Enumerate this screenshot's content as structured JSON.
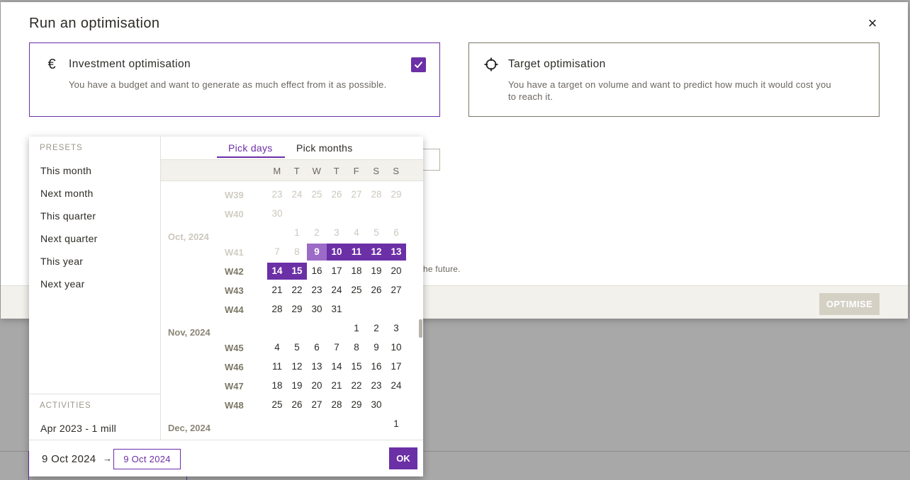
{
  "modal": {
    "title": "Run an optimisation",
    "close_icon": "×",
    "cards": {
      "investment": {
        "icon": "€",
        "title": "Investment optimisation",
        "description": "You have a budget and want to generate as much effect from it as possible.",
        "checked": true
      },
      "target": {
        "icon": "crosshair-icon",
        "title": "Target optimisation",
        "description": "You have a target on volume and want to predict how much it would cost you to reach it.",
        "checked": false
      }
    },
    "partial_text": "he future.",
    "optimise_label": "OPTIMISE"
  },
  "picker": {
    "presets_label": "PRESETS",
    "presets": [
      "This month",
      "Next month",
      "This quarter",
      "Next quarter",
      "This year",
      "Next year"
    ],
    "activities_label": "ACTIVITIES",
    "activities": [
      "Apr 2023 - 1 mill"
    ],
    "tabs": {
      "days": "Pick days",
      "months": "Pick months"
    },
    "weekdays": [
      "M",
      "T",
      "W",
      "T",
      "F",
      "S",
      "S"
    ],
    "months": {
      "oct": "Oct, 2024",
      "nov": "Nov, 2024",
      "dec": "Dec, 2024"
    },
    "weeks": {
      "w39": "W39",
      "w40": "W40",
      "w41": "W41",
      "w42": "W42",
      "w43": "W43",
      "w44": "W44",
      "w45": "W45",
      "w46": "W46",
      "w47": "W47",
      "w48": "W48"
    },
    "range_from": "9 Oct 2024",
    "range_arrow": "→",
    "range_to": "9 Oct 2024",
    "ok_label": "OK"
  },
  "colors": {
    "accent": "#6b2fa6",
    "accent_light": "#9b6bc7",
    "muted": "#ccc8bd"
  }
}
